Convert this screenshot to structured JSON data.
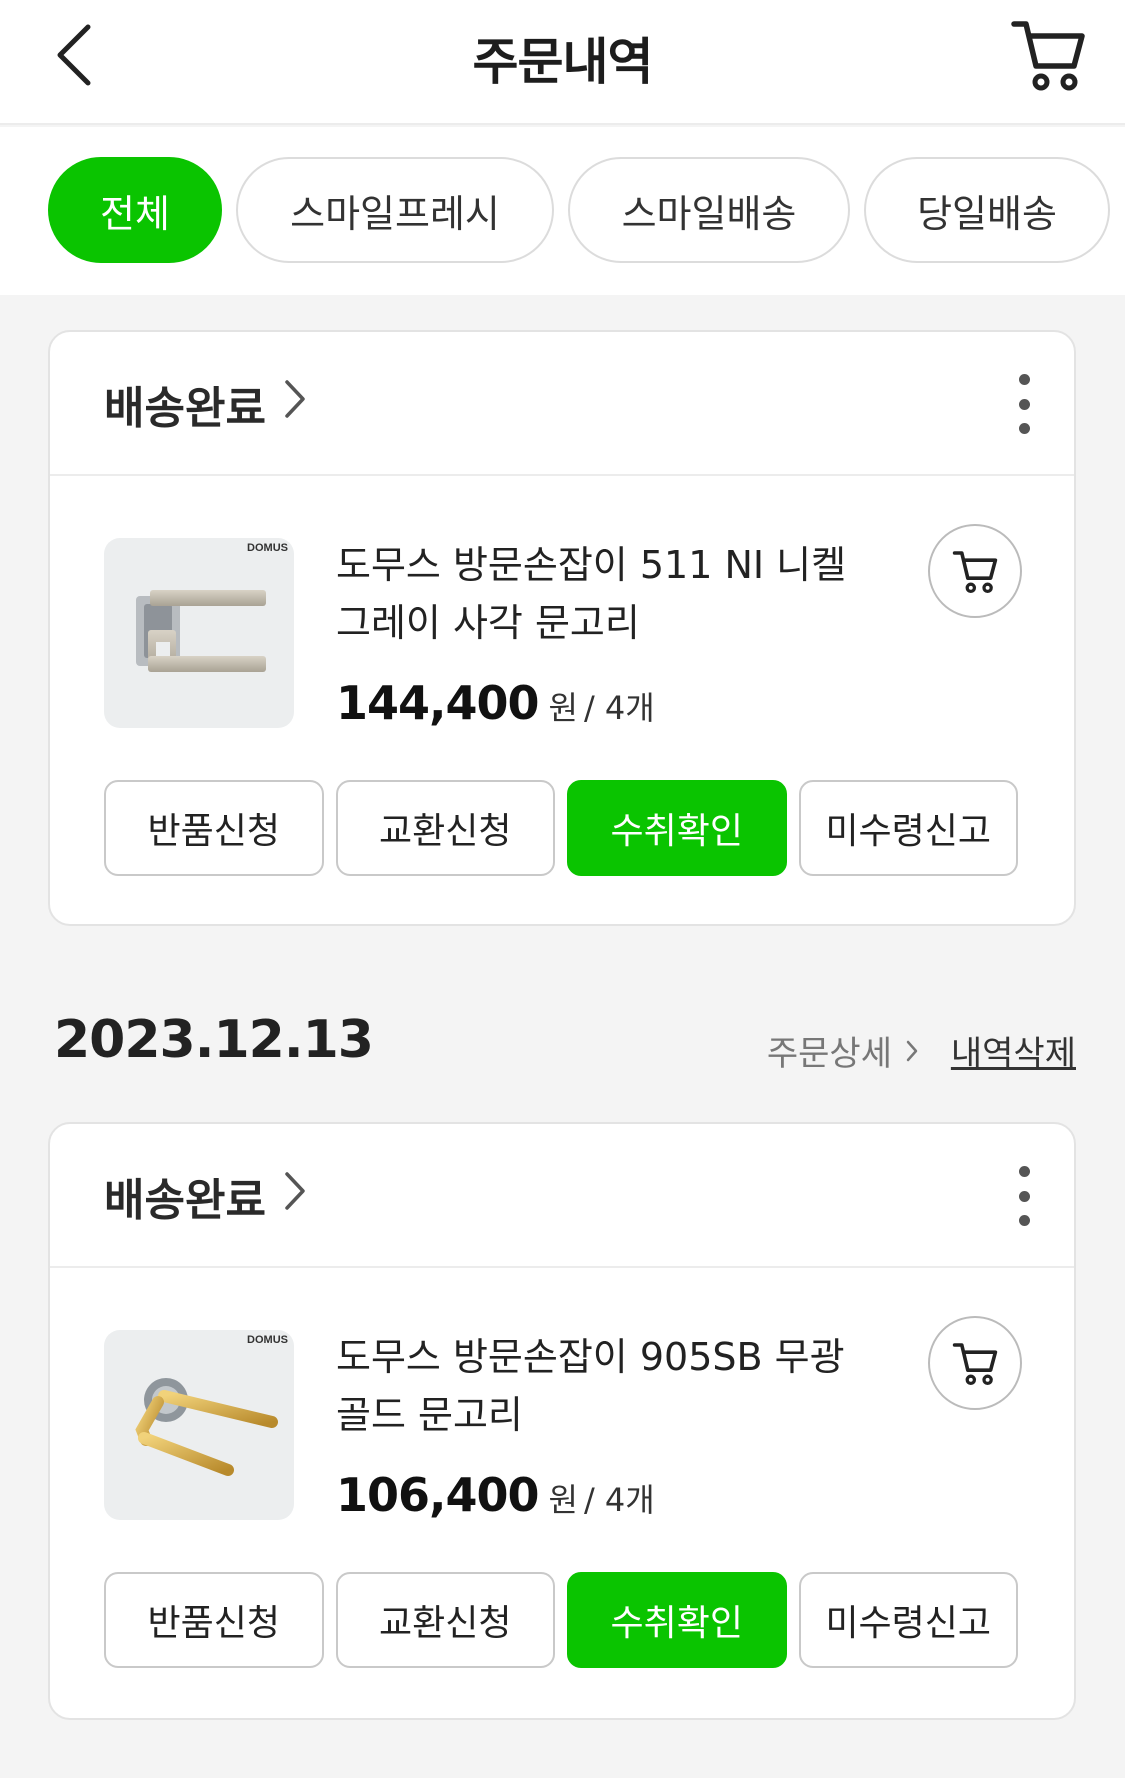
{
  "header": {
    "title": "주문내역",
    "back_icon": "chevron-left-icon",
    "cart_icon": "cart-icon"
  },
  "filters": [
    {
      "label": "전체",
      "active": true
    },
    {
      "label": "스마일프레시",
      "active": false
    },
    {
      "label": "스마일배송",
      "active": false
    },
    {
      "label": "당일배송",
      "active": false
    }
  ],
  "colors": {
    "accent": "#0ac400",
    "background": "#f4f4f4"
  },
  "orders": [
    {
      "status": "배송완료",
      "product": {
        "brand": "DOMUS",
        "name": "도무스 방문손잡이 511 NI 니켈 그레이 사각 문고리",
        "price": "144,400",
        "unit": "원",
        "qty": "/ 4개"
      },
      "actions": [
        "반품신청",
        "교환신청",
        "수취확인",
        "미수령신고"
      ]
    },
    {
      "date": "2023.12.13",
      "detail_label": "주문상세",
      "delete_label": "내역삭제",
      "status": "배송완료",
      "product": {
        "brand": "DOMUS",
        "name": "도무스 방문손잡이 905SB 무광 골드 문고리",
        "price": "106,400",
        "unit": "원",
        "qty": "/ 4개"
      },
      "actions": [
        "반품신청",
        "교환신청",
        "수취확인",
        "미수령신고"
      ]
    }
  ]
}
